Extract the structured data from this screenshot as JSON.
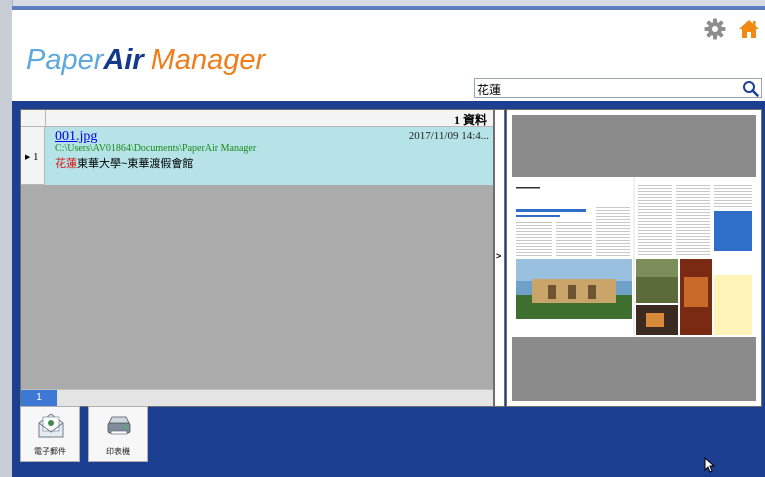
{
  "header": {
    "logo": {
      "part1": "Paper",
      "part2": "Air",
      "part3": "Manager"
    },
    "icons": {
      "settings": "gear-icon",
      "home": "home-icon"
    },
    "search": {
      "value": "花蓮",
      "icon": "search-icon"
    }
  },
  "results": {
    "count_label": "1 資料",
    "rows": [
      {
        "row_number": "1",
        "file_name": "001.jpg",
        "date": "2017/11/09 14:4...",
        "path": "C:\\Users\\AV01864\\Documents\\PaperAir Manager",
        "desc_highlight": "花蓮",
        "desc_rest": "東華大學~東華渡假會館"
      }
    ],
    "page": "1"
  },
  "splitter": {
    "arrow": ">"
  },
  "actions": {
    "email_label": "電子郵件",
    "email_icon": "email-icon",
    "scanner_label": "印表機",
    "scanner_icon": "scanner-icon"
  },
  "colors": {
    "brand_blue": "#1d3f91",
    "logo_light": "#5fa8dc",
    "logo_dark": "#13388c",
    "logo_orange": "#ef7d1a",
    "row_selected": "#b5e3e7",
    "search_highlight": "#e01010",
    "path_green": "#1a8a1a"
  }
}
